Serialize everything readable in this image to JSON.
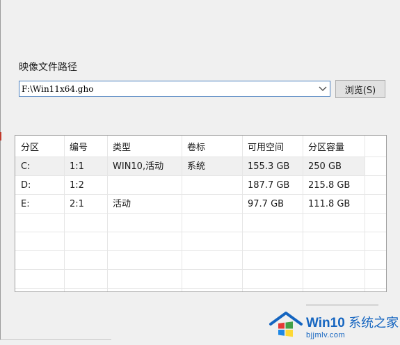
{
  "image_path": {
    "label": "映像文件路径",
    "value": "F:\\Win11x64.gho",
    "browse_label": "浏览(S)"
  },
  "partition_table": {
    "headers": [
      "分区",
      "编号",
      "类型",
      "卷标",
      "可用空间",
      "分区容量"
    ],
    "rows": [
      [
        "C:",
        "1:1",
        "WIN10,活动",
        "系统",
        "155.3 GB",
        "250 GB"
      ],
      [
        "D:",
        "1:2",
        "",
        "",
        "187.7 GB",
        "215.8 GB"
      ],
      [
        "E:",
        "2:1",
        "活动",
        "",
        "97.7 GB",
        "111.8 GB"
      ]
    ]
  },
  "watermark": {
    "title": "Win10",
    "title_cn": "系统之家",
    "url": "bjjmlv.com"
  },
  "colors": {
    "accent": "#1565c0",
    "input_border": "#4a7fbf",
    "selected_row": "#f0f0f0"
  }
}
